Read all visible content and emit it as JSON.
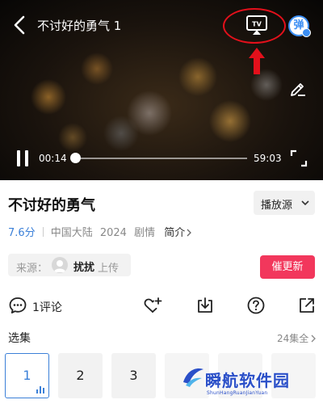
{
  "player": {
    "title": "不讨好的勇气 1",
    "current_time": "00:14",
    "total_time": "59:03",
    "progress_fraction": 0.005,
    "danmaku_label": "弹"
  },
  "info": {
    "title": "不讨好的勇气",
    "source_button": "播放源",
    "score": "7.6分",
    "region": "中国大陆",
    "year": "2024",
    "genre": "剧情",
    "intro": "简介"
  },
  "uploader": {
    "source_label": "来源：",
    "name": "扰扰",
    "action": "上传"
  },
  "urge_update": "催更新",
  "actions": {
    "comment_label": "1评论"
  },
  "episodes": {
    "header": "选集",
    "count": "24集全",
    "items": [
      {
        "label": "1",
        "active": true
      },
      {
        "label": "2",
        "active": false
      },
      {
        "label": "3",
        "active": false
      },
      {
        "label": "",
        "active": false
      },
      {
        "label": "",
        "active": false
      },
      {
        "label": "",
        "active": false
      }
    ]
  },
  "watermark": {
    "text": "瞬航软件园",
    "subtext": "ShunHangRuanJianYuan"
  },
  "colors": {
    "accent_blue": "#3b80d8",
    "urge_red": "#f2375c",
    "highlight_red": "#e3101b"
  },
  "icons": [
    "back-arrow-icon",
    "tv-cast-icon",
    "danmaku-icon",
    "edit-pencil-icon",
    "pause-icon",
    "fullscreen-icon",
    "comment-icon",
    "favorite-add-icon",
    "download-icon",
    "help-icon",
    "share-icon"
  ]
}
